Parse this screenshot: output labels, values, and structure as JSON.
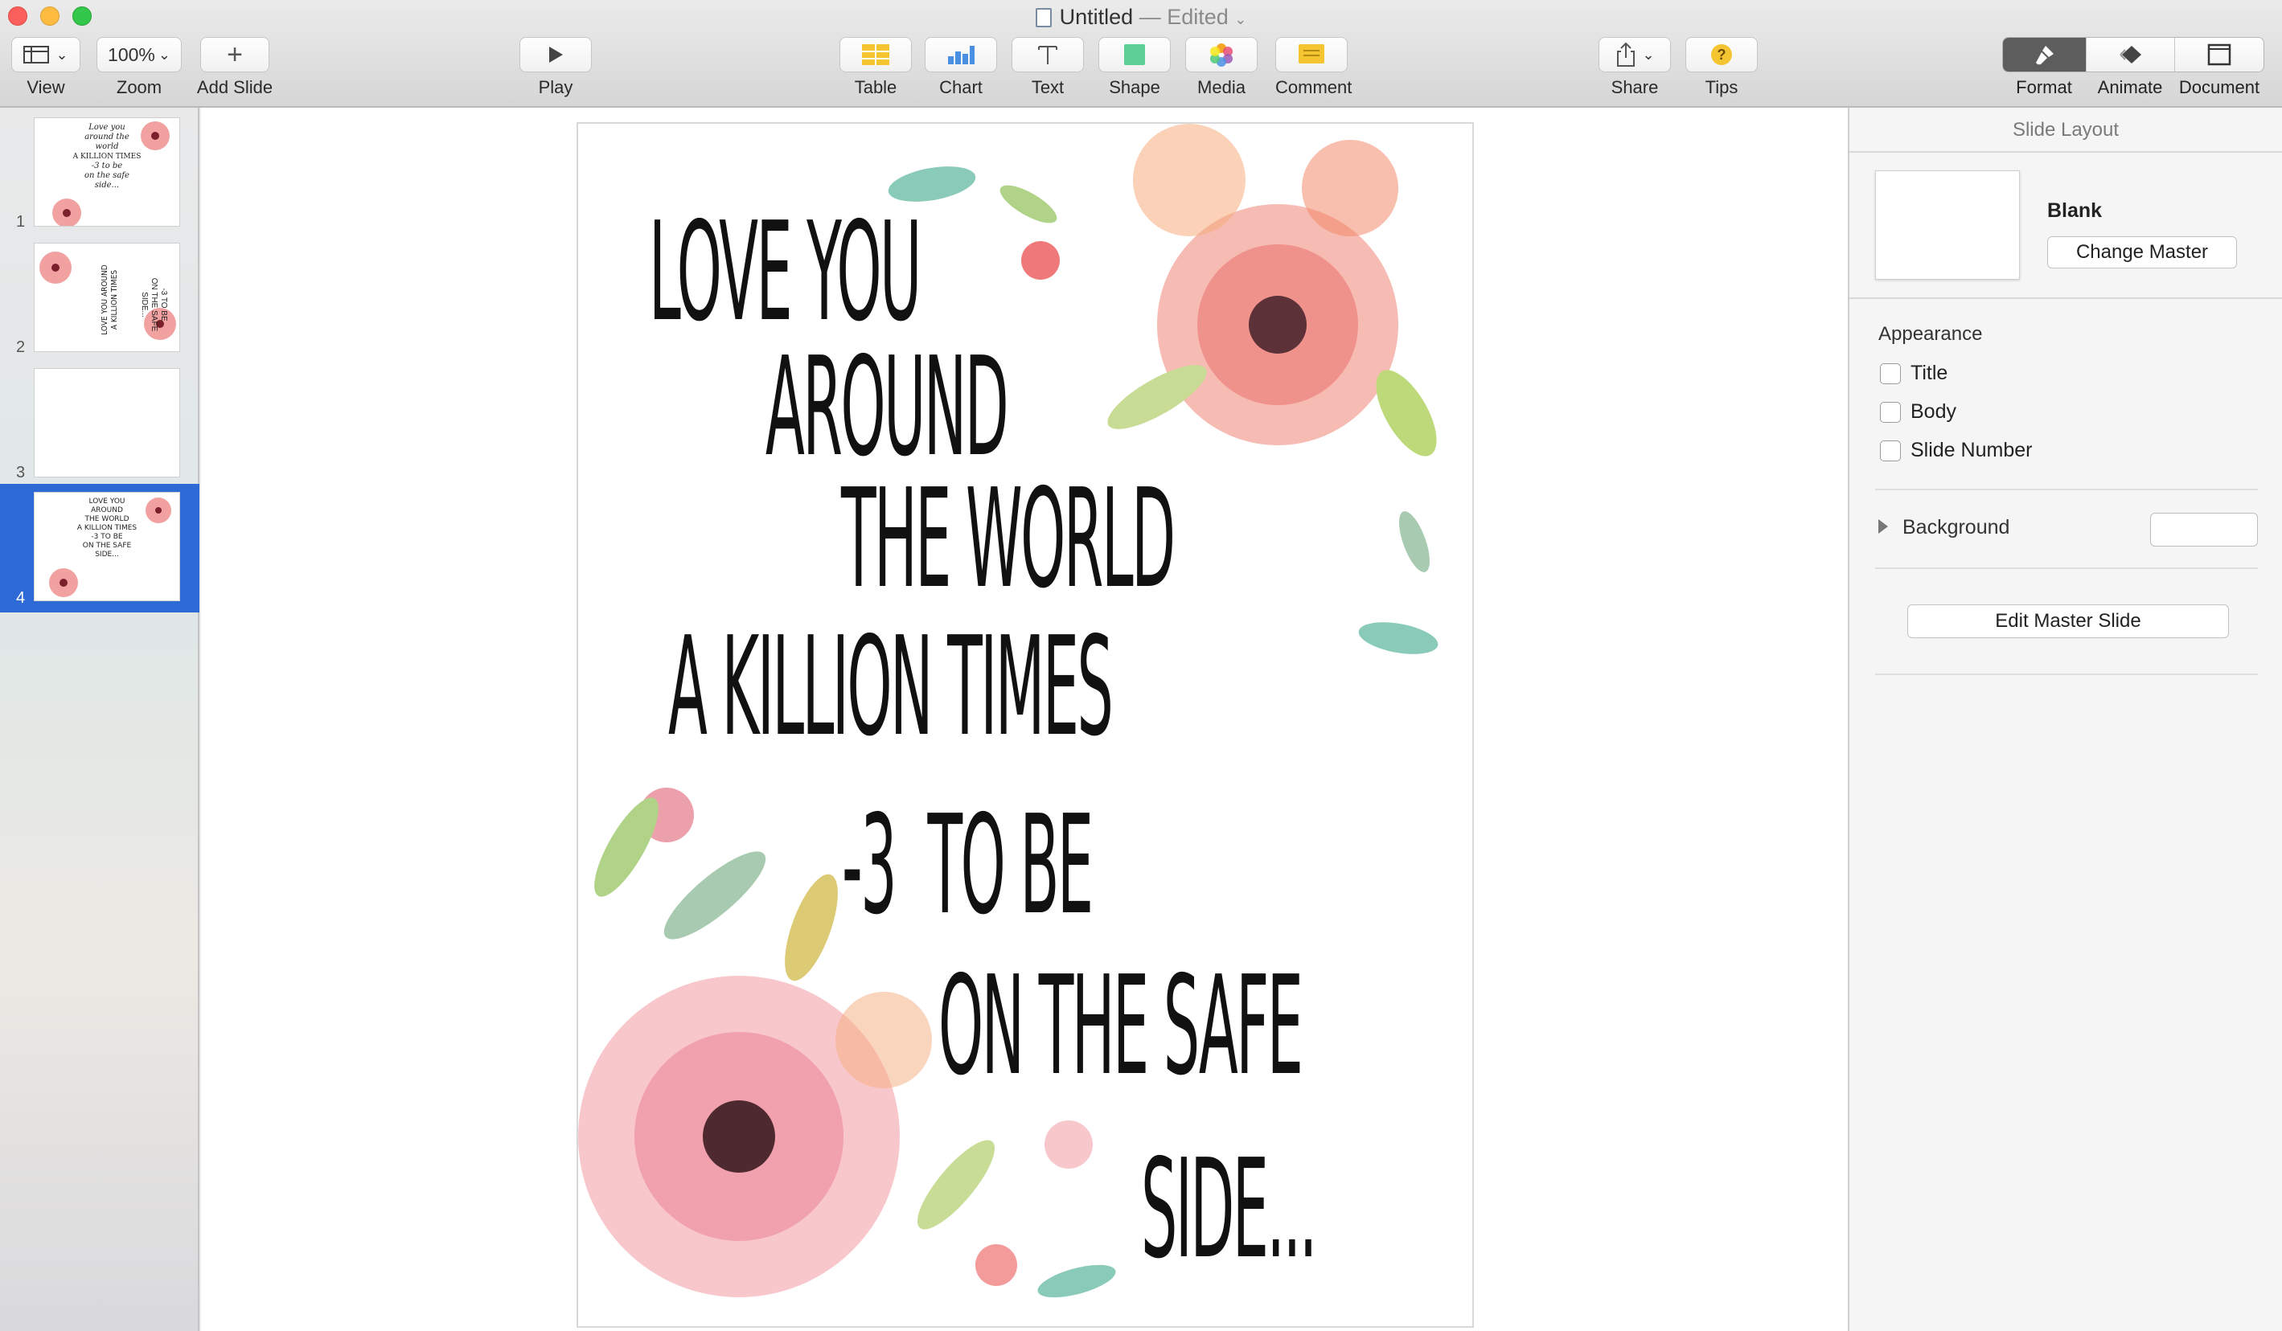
{
  "window": {
    "title": "Untitled",
    "status": "— Edited"
  },
  "toolbar": {
    "view": "View",
    "zoom_value": "100%",
    "zoom": "Zoom",
    "add_slide": "Add Slide",
    "play": "Play",
    "table": "Table",
    "chart": "Chart",
    "text": "Text",
    "shape": "Shape",
    "media": "Media",
    "comment": "Comment",
    "share": "Share",
    "tips": "Tips",
    "format": "Format",
    "animate": "Animate",
    "document": "Document"
  },
  "slides": [
    {
      "number": "1",
      "thumb_lines": [
        "Love you",
        "around the",
        "world",
        "A KILLION TIMES",
        "-3 to be",
        "on the safe",
        "side..."
      ]
    },
    {
      "number": "2",
      "thumb_lines": [
        "LOVE YOU AROUND",
        "A KILLION TIMES",
        "-3 TO BE",
        "ON THE SAFE",
        "SIDE..."
      ]
    },
    {
      "number": "3",
      "thumb_lines": []
    },
    {
      "number": "4",
      "thumb_lines": [
        "LOVE YOU",
        "AROUND",
        "THE WORLD",
        "A KILLION TIMES",
        "-3 TO BE",
        "ON THE SAFE",
        "SIDE..."
      ]
    }
  ],
  "slide_text": {
    "line1": "LOVE YOU",
    "line2": "AROUND",
    "line3": "THE WORLD",
    "line4": "A KILLION TIMES",
    "line5": "-3  TO BE",
    "line6": "ON THE SAFE",
    "line7": "SIDE..."
  },
  "inspector": {
    "header": "Slide Layout",
    "master_name": "Blank",
    "change_master": "Change Master",
    "appearance": "Appearance",
    "title": "Title",
    "body": "Body",
    "slide_number": "Slide Number",
    "background": "Background",
    "edit_master": "Edit Master Slide"
  },
  "colors": {
    "selection": "#2d6ad6",
    "format_tab": "#5d5d5d"
  }
}
